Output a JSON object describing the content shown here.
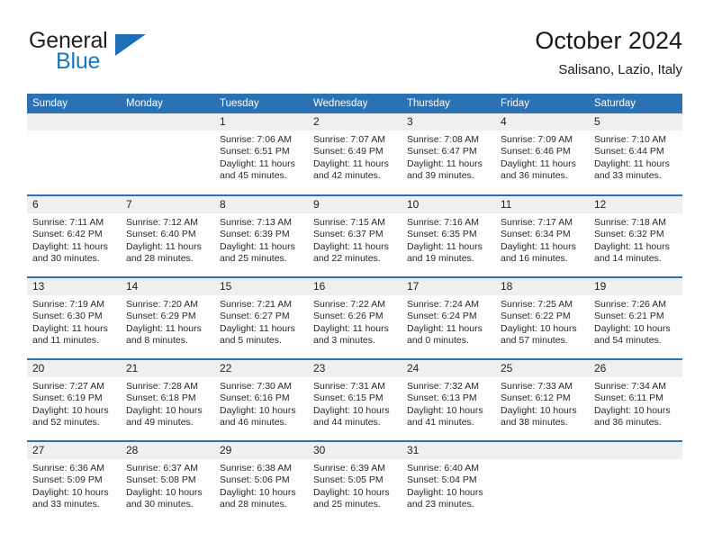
{
  "brand": {
    "word_one": "General",
    "word_two": "Blue",
    "triangle_icon": "triangle-icon",
    "accent_blue": "#1479bd",
    "header_blue": "#2b72b4"
  },
  "header": {
    "title": "October 2024",
    "subtitle": "Salisano, Lazio, Italy"
  },
  "calendar": {
    "weekday_headers": [
      "Sunday",
      "Monday",
      "Tuesday",
      "Wednesday",
      "Thursday",
      "Friday",
      "Saturday"
    ],
    "weeks": [
      [
        {
          "day": "",
          "sunrise": "",
          "sunset": "",
          "daylight": ""
        },
        {
          "day": "",
          "sunrise": "",
          "sunset": "",
          "daylight": ""
        },
        {
          "day": "1",
          "sunrise": "Sunrise: 7:06 AM",
          "sunset": "Sunset: 6:51 PM",
          "daylight": "Daylight: 11 hours and 45 minutes."
        },
        {
          "day": "2",
          "sunrise": "Sunrise: 7:07 AM",
          "sunset": "Sunset: 6:49 PM",
          "daylight": "Daylight: 11 hours and 42 minutes."
        },
        {
          "day": "3",
          "sunrise": "Sunrise: 7:08 AM",
          "sunset": "Sunset: 6:47 PM",
          "daylight": "Daylight: 11 hours and 39 minutes."
        },
        {
          "day": "4",
          "sunrise": "Sunrise: 7:09 AM",
          "sunset": "Sunset: 6:46 PM",
          "daylight": "Daylight: 11 hours and 36 minutes."
        },
        {
          "day": "5",
          "sunrise": "Sunrise: 7:10 AM",
          "sunset": "Sunset: 6:44 PM",
          "daylight": "Daylight: 11 hours and 33 minutes."
        }
      ],
      [
        {
          "day": "6",
          "sunrise": "Sunrise: 7:11 AM",
          "sunset": "Sunset: 6:42 PM",
          "daylight": "Daylight: 11 hours and 30 minutes."
        },
        {
          "day": "7",
          "sunrise": "Sunrise: 7:12 AM",
          "sunset": "Sunset: 6:40 PM",
          "daylight": "Daylight: 11 hours and 28 minutes."
        },
        {
          "day": "8",
          "sunrise": "Sunrise: 7:13 AM",
          "sunset": "Sunset: 6:39 PM",
          "daylight": "Daylight: 11 hours and 25 minutes."
        },
        {
          "day": "9",
          "sunrise": "Sunrise: 7:15 AM",
          "sunset": "Sunset: 6:37 PM",
          "daylight": "Daylight: 11 hours and 22 minutes."
        },
        {
          "day": "10",
          "sunrise": "Sunrise: 7:16 AM",
          "sunset": "Sunset: 6:35 PM",
          "daylight": "Daylight: 11 hours and 19 minutes."
        },
        {
          "day": "11",
          "sunrise": "Sunrise: 7:17 AM",
          "sunset": "Sunset: 6:34 PM",
          "daylight": "Daylight: 11 hours and 16 minutes."
        },
        {
          "day": "12",
          "sunrise": "Sunrise: 7:18 AM",
          "sunset": "Sunset: 6:32 PM",
          "daylight": "Daylight: 11 hours and 14 minutes."
        }
      ],
      [
        {
          "day": "13",
          "sunrise": "Sunrise: 7:19 AM",
          "sunset": "Sunset: 6:30 PM",
          "daylight": "Daylight: 11 hours and 11 minutes."
        },
        {
          "day": "14",
          "sunrise": "Sunrise: 7:20 AM",
          "sunset": "Sunset: 6:29 PM",
          "daylight": "Daylight: 11 hours and 8 minutes."
        },
        {
          "day": "15",
          "sunrise": "Sunrise: 7:21 AM",
          "sunset": "Sunset: 6:27 PM",
          "daylight": "Daylight: 11 hours and 5 minutes."
        },
        {
          "day": "16",
          "sunrise": "Sunrise: 7:22 AM",
          "sunset": "Sunset: 6:26 PM",
          "daylight": "Daylight: 11 hours and 3 minutes."
        },
        {
          "day": "17",
          "sunrise": "Sunrise: 7:24 AM",
          "sunset": "Sunset: 6:24 PM",
          "daylight": "Daylight: 11 hours and 0 minutes."
        },
        {
          "day": "18",
          "sunrise": "Sunrise: 7:25 AM",
          "sunset": "Sunset: 6:22 PM",
          "daylight": "Daylight: 10 hours and 57 minutes."
        },
        {
          "day": "19",
          "sunrise": "Sunrise: 7:26 AM",
          "sunset": "Sunset: 6:21 PM",
          "daylight": "Daylight: 10 hours and 54 minutes."
        }
      ],
      [
        {
          "day": "20",
          "sunrise": "Sunrise: 7:27 AM",
          "sunset": "Sunset: 6:19 PM",
          "daylight": "Daylight: 10 hours and 52 minutes."
        },
        {
          "day": "21",
          "sunrise": "Sunrise: 7:28 AM",
          "sunset": "Sunset: 6:18 PM",
          "daylight": "Daylight: 10 hours and 49 minutes."
        },
        {
          "day": "22",
          "sunrise": "Sunrise: 7:30 AM",
          "sunset": "Sunset: 6:16 PM",
          "daylight": "Daylight: 10 hours and 46 minutes."
        },
        {
          "day": "23",
          "sunrise": "Sunrise: 7:31 AM",
          "sunset": "Sunset: 6:15 PM",
          "daylight": "Daylight: 10 hours and 44 minutes."
        },
        {
          "day": "24",
          "sunrise": "Sunrise: 7:32 AM",
          "sunset": "Sunset: 6:13 PM",
          "daylight": "Daylight: 10 hours and 41 minutes."
        },
        {
          "day": "25",
          "sunrise": "Sunrise: 7:33 AM",
          "sunset": "Sunset: 6:12 PM",
          "daylight": "Daylight: 10 hours and 38 minutes."
        },
        {
          "day": "26",
          "sunrise": "Sunrise: 7:34 AM",
          "sunset": "Sunset: 6:11 PM",
          "daylight": "Daylight: 10 hours and 36 minutes."
        }
      ],
      [
        {
          "day": "27",
          "sunrise": "Sunrise: 6:36 AM",
          "sunset": "Sunset: 5:09 PM",
          "daylight": "Daylight: 10 hours and 33 minutes."
        },
        {
          "day": "28",
          "sunrise": "Sunrise: 6:37 AM",
          "sunset": "Sunset: 5:08 PM",
          "daylight": "Daylight: 10 hours and 30 minutes."
        },
        {
          "day": "29",
          "sunrise": "Sunrise: 6:38 AM",
          "sunset": "Sunset: 5:06 PM",
          "daylight": "Daylight: 10 hours and 28 minutes."
        },
        {
          "day": "30",
          "sunrise": "Sunrise: 6:39 AM",
          "sunset": "Sunset: 5:05 PM",
          "daylight": "Daylight: 10 hours and 25 minutes."
        },
        {
          "day": "31",
          "sunrise": "Sunrise: 6:40 AM",
          "sunset": "Sunset: 5:04 PM",
          "daylight": "Daylight: 10 hours and 23 minutes."
        },
        {
          "day": "",
          "sunrise": "",
          "sunset": "",
          "daylight": ""
        },
        {
          "day": "",
          "sunrise": "",
          "sunset": "",
          "daylight": ""
        }
      ]
    ]
  }
}
